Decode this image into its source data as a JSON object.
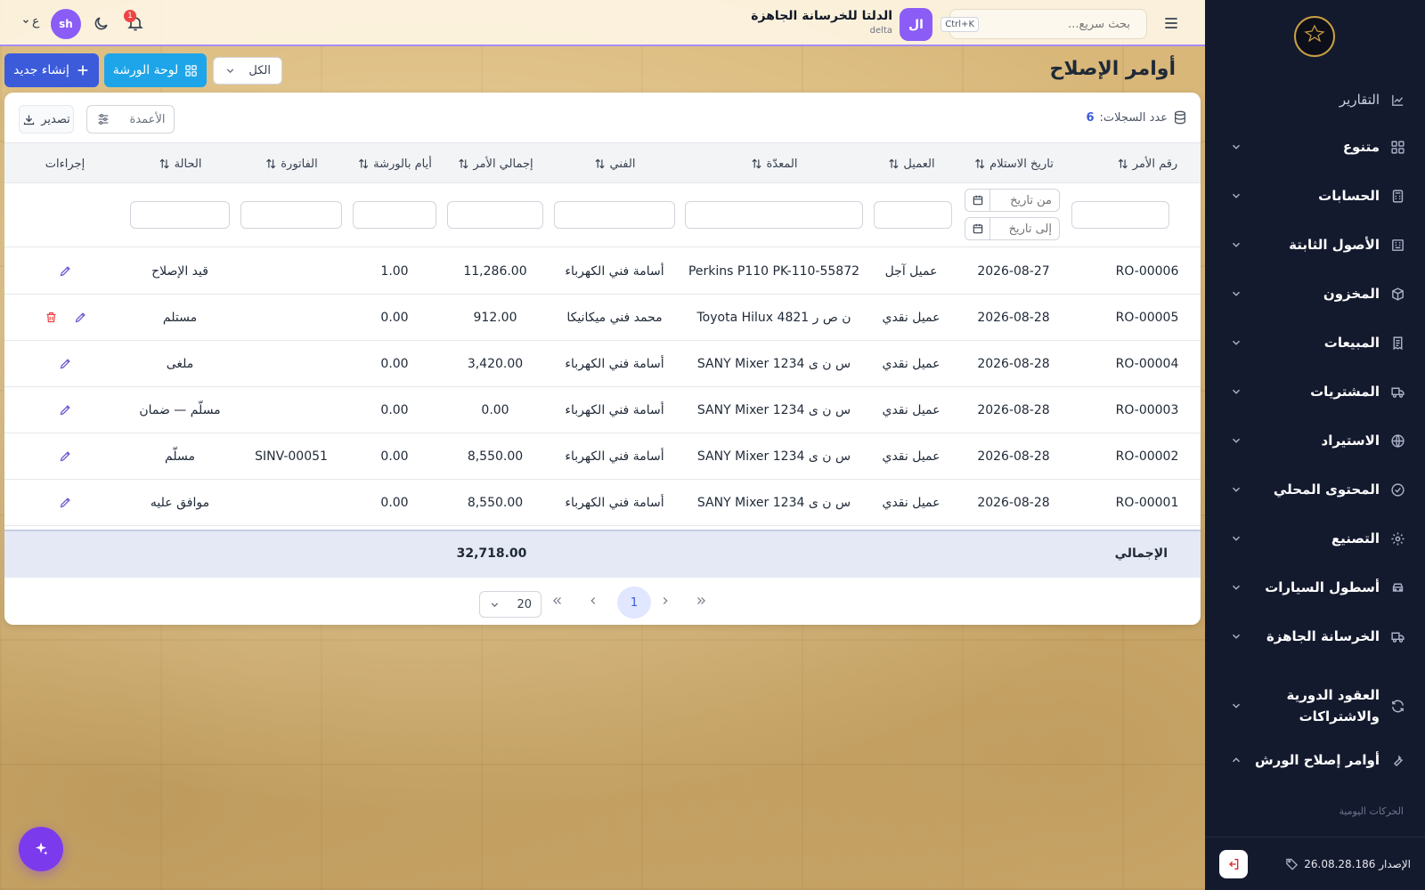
{
  "sidebar": {
    "items": [
      {
        "label": "التقارير",
        "icon": "chart-icon",
        "chevron": false
      },
      {
        "label": "متنوع",
        "icon": "grid-icon",
        "chevron": true
      },
      {
        "label": "الحسابات",
        "icon": "calculator-icon",
        "chevron": true
      },
      {
        "label": "الأصول الثابتة",
        "icon": "building-icon",
        "chevron": true
      },
      {
        "label": "المخزون",
        "icon": "box-icon",
        "chevron": true
      },
      {
        "label": "المبيعات",
        "icon": "receipt-icon",
        "chevron": true
      },
      {
        "label": "المشتريات",
        "icon": "truck-icon",
        "chevron": true
      },
      {
        "label": "الاستيراد",
        "icon": "globe-icon",
        "chevron": true
      },
      {
        "label": "المحتوى المحلي",
        "icon": "check-circle-icon",
        "chevron": true
      },
      {
        "label": "التصنيع",
        "icon": "cog-icon",
        "chevron": true
      },
      {
        "label": "أسطول السيارات",
        "icon": "car-icon",
        "chevron": true
      },
      {
        "label": "الخرسانة الجاهزة",
        "icon": "truck-icon",
        "chevron": true
      },
      {
        "label": "العقود الدورية والاشتراكات",
        "icon": "refresh-icon",
        "chevron": true
      },
      {
        "label": "أوامر إصلاح الورش",
        "icon": "wrench-icon",
        "chevron": true,
        "expanded": true
      }
    ],
    "sub_label": "الحركات اليومية",
    "version": "الإصدار 26.08.28.186"
  },
  "header": {
    "search_placeholder": "بحث سريع...",
    "shortcut": "Ctrl+K",
    "company_initial": "ال",
    "company_name": "الدلتا للخرسانة الجاهزة",
    "company_code": "delta",
    "notif_count": "1",
    "user_initials": "sh",
    "lang": "ع"
  },
  "page": {
    "title": "أوامر الإصلاح",
    "create_label": "إنشاء جديد",
    "board_label": "لوحة الورشة",
    "filter_value": "الكل"
  },
  "toolbar": {
    "records_label": "عدد السجلات:",
    "records_count": "6",
    "columns_label": "الأعمدة",
    "export_label": "تصدير"
  },
  "table": {
    "columns": {
      "order_no": "رقم الأمر",
      "received_date": "تاريخ الاستلام",
      "client": "العميل",
      "equipment": "المعدّة",
      "technician": "الفني",
      "order_total": "إجمالي الأمر",
      "workshop_days": "أيام بالورشة",
      "invoice": "الفاتورة",
      "status": "الحالة",
      "actions": "إجراءات"
    },
    "filters": {
      "from_date": "من تاريخ",
      "to_date": "إلى تاريخ"
    },
    "rows": [
      {
        "order_no": "RO-00006",
        "date": "2026-08-27",
        "client": "عميل آجل",
        "equipment": "Perkins P110 PK-110-55872",
        "technician": "أسامة فني الكهرباء",
        "total": "11,286.00",
        "days": "1.00",
        "invoice": "",
        "status": "قيد الإصلاح",
        "deletable": false
      },
      {
        "order_no": "RO-00005",
        "date": "2026-08-28",
        "client": "عميل نقدي",
        "equipment": "Toyota Hilux ن ص ر 4821",
        "technician": "محمد فني ميكانيكا",
        "total": "912.00",
        "days": "0.00",
        "invoice": "",
        "status": "مستلم",
        "deletable": true
      },
      {
        "order_no": "RO-00004",
        "date": "2026-08-28",
        "client": "عميل نقدي",
        "equipment": "SANY Mixer س ن ى 1234",
        "technician": "أسامة فني الكهرباء",
        "total": "3,420.00",
        "days": "0.00",
        "invoice": "",
        "status": "ملغى",
        "deletable": false
      },
      {
        "order_no": "RO-00003",
        "date": "2026-08-28",
        "client": "عميل نقدي",
        "equipment": "SANY Mixer س ن ى 1234",
        "technician": "أسامة فني الكهرباء",
        "total": "0.00",
        "days": "0.00",
        "invoice": "",
        "status": "مسلّم — ضمان",
        "deletable": false
      },
      {
        "order_no": "RO-00002",
        "date": "2026-08-28",
        "client": "عميل نقدي",
        "equipment": "SANY Mixer س ن ى 1234",
        "technician": "أسامة فني الكهرباء",
        "total": "8,550.00",
        "days": "0.00",
        "invoice": "SINV-00051",
        "status": "مسلّم",
        "deletable": false
      },
      {
        "order_no": "RO-00001",
        "date": "2026-08-28",
        "client": "عميل نقدي",
        "equipment": "SANY Mixer س ن ى 1234",
        "technician": "أسامة فني الكهرباء",
        "total": "8,550.00",
        "days": "0.00",
        "invoice": "",
        "status": "موافق عليه",
        "deletable": false
      }
    ],
    "total_label": "الإجمالي",
    "total_value": "32,718.00"
  },
  "pager": {
    "current_page": "1",
    "page_size": "20"
  },
  "colors": {
    "accent": "#3b5bdb",
    "board": "#1ea5e9",
    "sidebar_bg": "#141a2e",
    "avatar": "#8b5cf6",
    "danger": "#ef4444"
  }
}
